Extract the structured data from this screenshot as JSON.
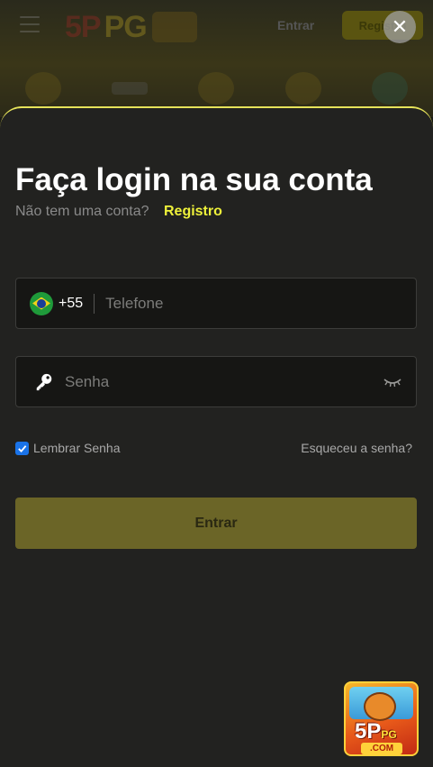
{
  "background": {
    "brand": "5P PG",
    "brand_primary": "5P",
    "brand_secondary": "PG",
    "login_link": "Entrar",
    "register_button": "Registro"
  },
  "modal": {
    "close_icon": "close-icon",
    "title": "Faça login na sua conta",
    "no_account_text": "Não tem uma conta?",
    "register_link": "Registro",
    "phone": {
      "country_flag": "brazil-flag-icon",
      "dial_code": "+55",
      "value": "",
      "placeholder": "Telefone"
    },
    "password": {
      "leading_icon": "key-icon",
      "value": "",
      "placeholder": "Senha",
      "toggle_icon": "eye-closed-icon"
    },
    "remember_password": {
      "label": "Lembrar Senha",
      "checked": true
    },
    "forgot_password_link": "Esqueceu a senha?",
    "submit_label": "Entrar"
  },
  "app_logo": {
    "text": "5P",
    "sub_text": "PG",
    "domain": ".COM"
  },
  "colors": {
    "accent_yellow": "#eef13a",
    "sheet_border": "#e6e35a",
    "sheet_background": "#222220",
    "input_background": "#161614",
    "submit_background": "#6b6527",
    "checkbox_blue": "#1a73e8"
  }
}
